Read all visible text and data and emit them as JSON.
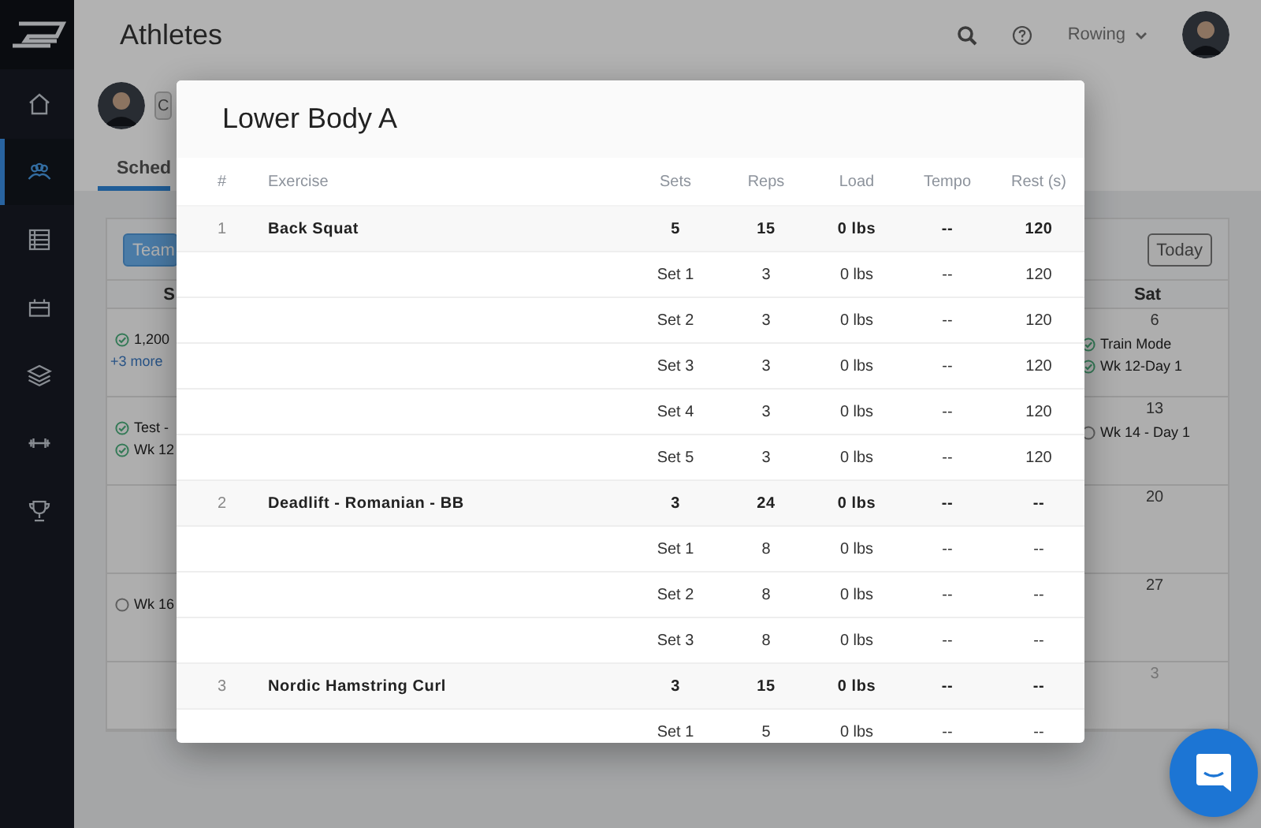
{
  "nav": [
    {
      "selected": false
    },
    {
      "selected": true
    },
    {
      "selected": false
    },
    {
      "selected": false
    },
    {
      "selected": false
    },
    {
      "selected": false
    },
    {
      "selected": false
    }
  ],
  "header": {
    "title": "Athletes",
    "sport": "Rowing"
  },
  "profile": {
    "button": "C",
    "tabs": [
      {
        "label": "Sched",
        "selected": true
      }
    ]
  },
  "calendar": {
    "view_button": {
      "label": "Team",
      "selected": true
    },
    "today_button": "Today",
    "columns": [
      "S",
      "Sat"
    ],
    "weeks": [
      {
        "sun": {
          "events": [
            {
              "label": "1,200",
              "done": true
            }
          ],
          "more": "+3 more"
        },
        "sat": {
          "day": "6",
          "muted": false,
          "events": [
            {
              "label": "Train Mode",
              "done": true
            },
            {
              "label": "Wk 12-Day 1",
              "done": true
            }
          ]
        }
      },
      {
        "sun": {
          "events": [
            {
              "label": "Test -",
              "done": true
            },
            {
              "label": "Wk 12",
              "done": true
            }
          ]
        },
        "sat": {
          "day": "13",
          "muted": false,
          "events": [
            {
              "label": "Wk 14 - Day 1",
              "done": false
            }
          ]
        }
      },
      {
        "sat": {
          "day": "20",
          "muted": false
        }
      },
      {
        "sun": {
          "events": [
            {
              "label": "Wk 16",
              "done": false
            }
          ]
        },
        "sat": {
          "day": "27",
          "muted": false
        }
      },
      {
        "sat": {
          "day": "3",
          "muted": true
        }
      }
    ]
  },
  "modal": {
    "title": "Lower Body A",
    "columns": [
      "#",
      "Exercise",
      "Sets",
      "Reps",
      "Load",
      "Tempo",
      "Rest (s)"
    ],
    "exercises": [
      {
        "number": "1",
        "name": "Back Squat",
        "sets": "5",
        "reps": "15",
        "load": "0 lbs",
        "tempo": "--",
        "rest": "120",
        "set_rows": [
          {
            "label": "Set 1",
            "reps": "3",
            "load": "0 lbs",
            "tempo": "--",
            "rest": "120"
          },
          {
            "label": "Set 2",
            "reps": "3",
            "load": "0 lbs",
            "tempo": "--",
            "rest": "120"
          },
          {
            "label": "Set 3",
            "reps": "3",
            "load": "0 lbs",
            "tempo": "--",
            "rest": "120"
          },
          {
            "label": "Set 4",
            "reps": "3",
            "load": "0 lbs",
            "tempo": "--",
            "rest": "120"
          },
          {
            "label": "Set 5",
            "reps": "3",
            "load": "0 lbs",
            "tempo": "--",
            "rest": "120"
          }
        ]
      },
      {
        "number": "2",
        "name": "Deadlift - Romanian - BB",
        "sets": "3",
        "reps": "24",
        "load": "0 lbs",
        "tempo": "--",
        "rest": "--",
        "set_rows": [
          {
            "label": "Set 1",
            "reps": "8",
            "load": "0 lbs",
            "tempo": "--",
            "rest": "--"
          },
          {
            "label": "Set 2",
            "reps": "8",
            "load": "0 lbs",
            "tempo": "--",
            "rest": "--"
          },
          {
            "label": "Set 3",
            "reps": "8",
            "load": "0 lbs",
            "tempo": "--",
            "rest": "--"
          }
        ]
      },
      {
        "number": "3",
        "name": "Nordic Hamstring Curl",
        "sets": "3",
        "reps": "15",
        "load": "0 lbs",
        "tempo": "--",
        "rest": "--",
        "set_rows": [
          {
            "label": "Set 1",
            "reps": "5",
            "load": "0 lbs",
            "tempo": "--",
            "rest": "--"
          }
        ]
      }
    ]
  }
}
